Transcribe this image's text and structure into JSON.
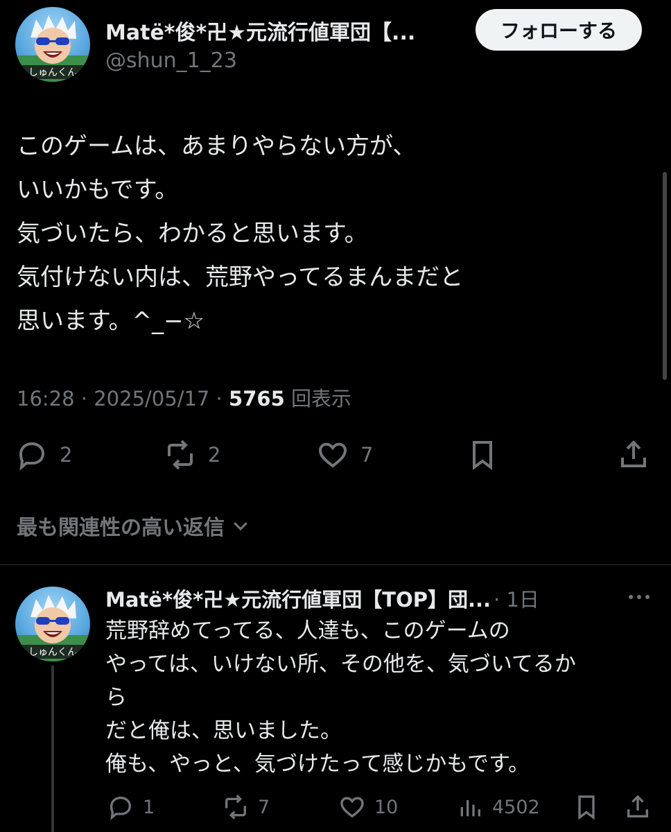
{
  "post": {
    "author_name": "Matë*俊*卍★元流行値軍団【...",
    "handle": "@shun_1_23",
    "follow_label": "フォローする",
    "body_lines": [
      "このゲームは、あまりやらない方が、",
      "いいかもです。",
      "気づいたら、わかると思います。",
      "気付けない内は、荒野やってるまんまだと",
      "思います。^_−☆"
    ],
    "time": "16:28",
    "date": "2025/05/17",
    "views_count": "5765",
    "views_label": "回表示",
    "replies": "2",
    "reposts": "2",
    "likes": "7"
  },
  "replies_sort": {
    "label": "最も関連性の高い返信"
  },
  "reply": {
    "author_name": "Matë*俊*卍★元流行値軍団【TOP】団...",
    "time": "· 1日",
    "body_lines": [
      "荒野辞めてってる、人達も、このゲームの",
      "やっては、いけない所、その他を、気づいてるか",
      "ら",
      "だと俺は、思いました。",
      "俺も、やっと、気づけたって感じかもです。"
    ],
    "replies": "1",
    "reposts": "7",
    "likes": "10",
    "views": "4502"
  },
  "avatar": {
    "caption": "しゅんくん"
  },
  "icons": {
    "reply": "reply-icon",
    "repost": "repost-icon",
    "like": "heart-icon",
    "bookmark": "bookmark-icon",
    "share": "share-icon",
    "views": "views-icon",
    "more": "more-icon",
    "chevron": "chevron-down-icon"
  },
  "colors": {
    "background": "#000000",
    "text": "#e7e9ea",
    "muted": "#71767b",
    "follow_bg": "#eff3f4"
  }
}
